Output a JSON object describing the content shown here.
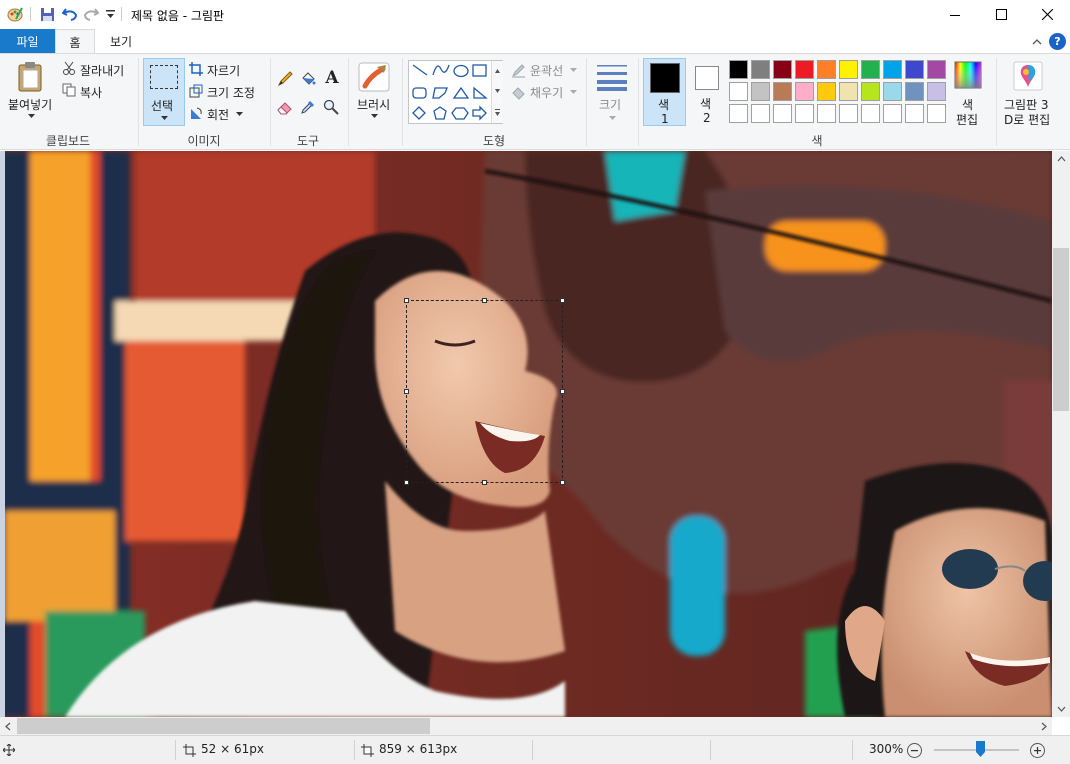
{
  "window": {
    "title": "제목 없음 - 그림판"
  },
  "tabs": {
    "file": "파일",
    "home": "홈",
    "view": "보기"
  },
  "clipboard": {
    "paste": "붙여넣기",
    "cut": "잘라내기",
    "copy": "복사",
    "group": "클립보드"
  },
  "image": {
    "select": "선택",
    "crop": "자르기",
    "resize": "크기 조정",
    "rotate": "회전",
    "group": "이미지"
  },
  "tools": {
    "group": "도구",
    "text_glyph": "A"
  },
  "brushes": {
    "label": "브러시"
  },
  "shapes": {
    "outline": "윤곽선",
    "fill": "채우기",
    "group": "도형"
  },
  "size": {
    "label": "크기"
  },
  "colors": {
    "color1": "색",
    "color1_num": "1",
    "color2": "색",
    "color2_num": "2",
    "edit_line1": "색",
    "edit_line2": "편집",
    "group": "색",
    "paint3d_line1": "그림판 3",
    "paint3d_line2": "D로 편집",
    "color1_value": "#000000",
    "color2_value": "#ffffff",
    "palette_row1": [
      "#000000",
      "#7f7f7f",
      "#880015",
      "#ed1c24",
      "#ff7f27",
      "#fff200",
      "#22b14c",
      "#00a2e8",
      "#3f48cc",
      "#a349a4"
    ],
    "palette_row2": [
      "#ffffff",
      "#c3c3c3",
      "#b97a57",
      "#ffaec9",
      "#ffc90e",
      "#efe4b0",
      "#b5e61d",
      "#99d9ea",
      "#7092be",
      "#c8bfe7"
    ]
  },
  "status": {
    "selection_size": "52 × 61px",
    "image_size": "859 × 613px",
    "zoom": "300%",
    "zoom_fraction": 0.55
  }
}
